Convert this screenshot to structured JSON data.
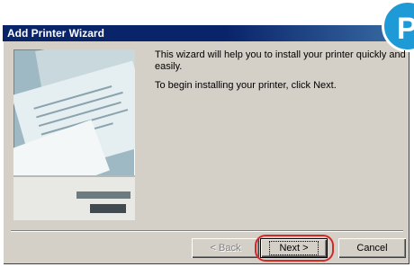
{
  "window": {
    "title": "Add Printer Wizard",
    "corner_badge": "P"
  },
  "content": {
    "intro": "This wizard will help you to install your printer quickly and easily.",
    "instruction": "To begin installing your printer, click Next."
  },
  "buttons": {
    "back": "< Back",
    "next": "Next >",
    "cancel": "Cancel"
  },
  "colors": {
    "title_bar": "#0a246a",
    "dialog_face": "#d4d0c8",
    "highlight_ring": "#d62828",
    "badge": "#1e9ad6"
  }
}
